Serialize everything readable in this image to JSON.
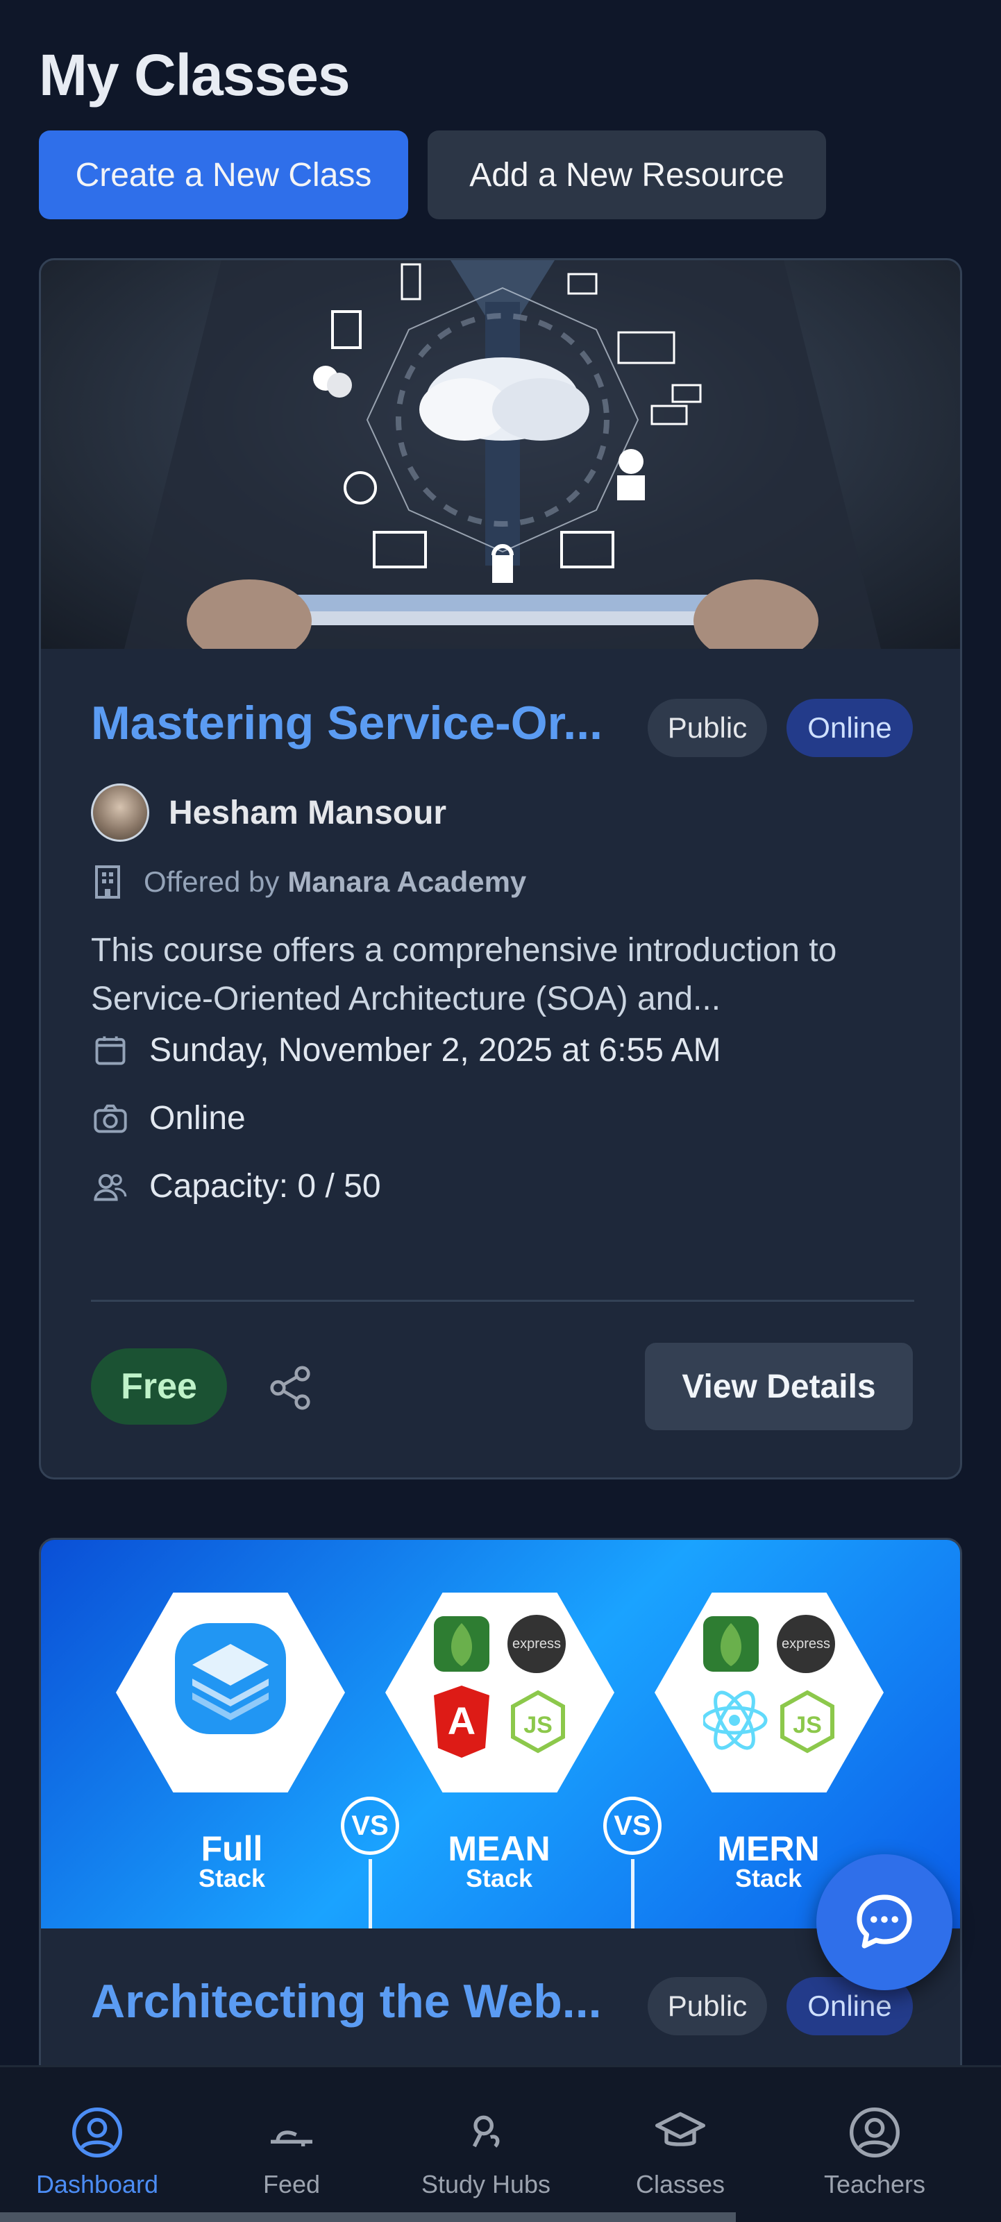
{
  "header": {
    "title": "My Classes"
  },
  "actions": {
    "create_label": "Create a New Class",
    "add_resource_label": "Add a New Resource"
  },
  "classes": [
    {
      "title": "Mastering Service-Or...",
      "visibility": "Public",
      "mode": "Online",
      "teacher": "Hesham Mansour",
      "offered_prefix": "Offered by",
      "academy": "Manara Academy",
      "description": "This course offers a comprehensive introduction to Service-Oriented Architecture (SOA) and...",
      "datetime": "Sunday, November 2, 2025 at 6:55 AM",
      "location": "Online",
      "capacity": "Capacity: 0 / 50",
      "price": "Free",
      "view_label": "View Details"
    },
    {
      "title": "Architecting the Web...",
      "visibility": "Public",
      "mode": "Online",
      "banner": {
        "col1_big": "Full",
        "col1_small": "Stack",
        "col2_big": "MEAN",
        "col2_small": "Stack",
        "col3_big": "MERN",
        "col3_small": "Stack",
        "vs": "VS"
      }
    }
  ],
  "nav": [
    {
      "label": "Dashboard",
      "icon": "user-circle-icon",
      "active": true
    },
    {
      "label": "Feed",
      "icon": "feed-icon"
    },
    {
      "label": "Study Hubs",
      "icon": "study-hubs-icon"
    },
    {
      "label": "Classes",
      "icon": "graduation-cap-icon"
    },
    {
      "label": "Teachers",
      "icon": "user-circle-icon"
    }
  ],
  "colors": {
    "background": "#0f1729",
    "primary": "#2f6fea",
    "card": "#1e283a",
    "title_link": "#5b9cf3",
    "price_bg": "#1b5233"
  }
}
